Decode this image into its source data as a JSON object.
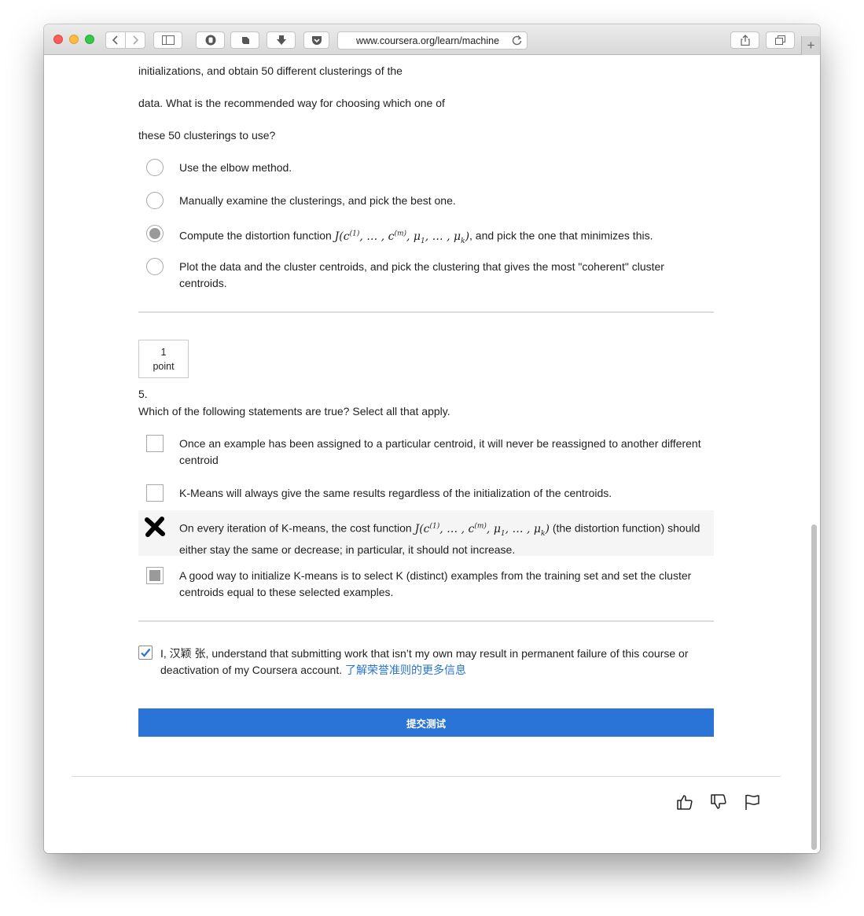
{
  "browser": {
    "url": "www.coursera.org/learn/machine",
    "back_icon": "chevron-left",
    "forward_icon": "chevron-right",
    "new_tab_label": "+"
  },
  "question4": {
    "text_lines": [
      "initializations, and obtain 50 different clusterings of the",
      "data. What is the recommended way for choosing which one of",
      "these 50 clusterings to use?"
    ],
    "options": [
      {
        "label": "Use the elbow method.",
        "selected": false
      },
      {
        "label": "Manually examine the clusterings, and pick the best one.",
        "selected": false
      },
      {
        "label_before": "Compute the distortion function ",
        "label_after": ", and pick the one that minimizes this.",
        "selected": true
      },
      {
        "label": "Plot the data and the cluster centroids, and pick the clustering that gives the most \"coherent\" cluster centroids.",
        "selected": false
      }
    ]
  },
  "question5": {
    "points_value": "1",
    "points_unit": "point",
    "number": "5.",
    "prompt": "Which of the following statements are true? Select all that apply.",
    "options": [
      {
        "label": "Once an example has been assigned to a particular centroid, it will never be reassigned to another different centroid",
        "state": "unchecked"
      },
      {
        "label": "K-Means will always give the same results regardless of the initialization of the centroids.",
        "state": "unchecked"
      },
      {
        "label_before": "On every iteration of K-means, the cost function ",
        "label_after": " (the distortion function) should either stay the same or decrease; in particular, it should not increase.",
        "state": "incorrect"
      },
      {
        "label": "A good way to initialize K-means is to select K (distinct) examples from the training set and set the cluster centroids equal to these selected examples.",
        "state": "checked"
      }
    ]
  },
  "honor_code": {
    "checked": true,
    "text": "I, 汉颖 张, understand that submitting work that isn’t my own may result in permanent failure of this course or deactivation of my Coursera account. ",
    "link": "了解荣誉准则的更多信息"
  },
  "submit_label": "提交测试",
  "colors": {
    "accent": "#2a73d7",
    "link": "#2a73cc",
    "selected_gray": "#9a9a9a"
  }
}
